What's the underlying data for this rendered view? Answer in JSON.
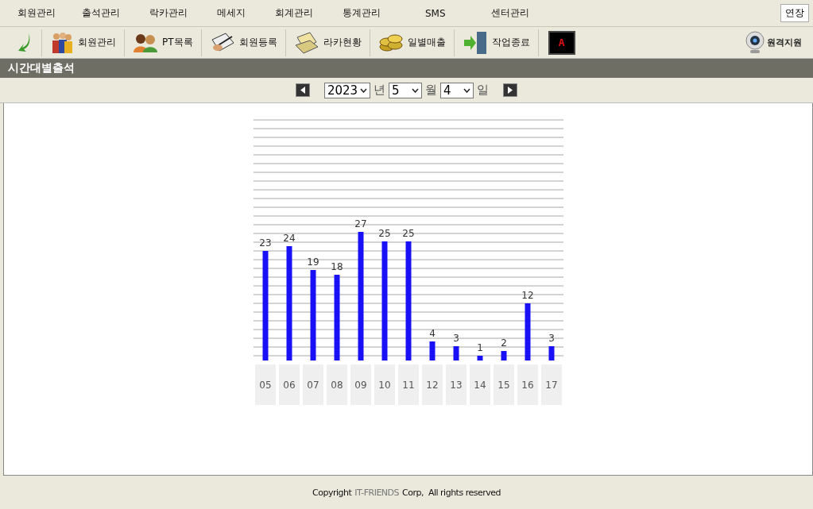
{
  "menu": [
    "회원관리",
    "출석관리",
    "락카관리",
    "메세지",
    "회계관리",
    "통계관리",
    "SMS",
    "센터관리"
  ],
  "extend_button": "연장",
  "toolbar": [
    {
      "kind": "arrow"
    },
    {
      "kind": "members",
      "label": "회원관리"
    },
    {
      "kind": "pt",
      "label": "PT목록"
    },
    {
      "kind": "register",
      "label": "회원등록"
    },
    {
      "kind": "locker",
      "label": "라카현황"
    },
    {
      "kind": "sales",
      "label": "일별매출"
    },
    {
      "kind": "exit",
      "label": "작업종료"
    },
    {
      "kind": "badge",
      "label": "A"
    }
  ],
  "remote_support": "원격지원",
  "section_title": "시간대별출석",
  "date": {
    "year": "2023",
    "year_unit": "년",
    "month": "5",
    "month_unit": "월",
    "day": "4",
    "day_unit": "일"
  },
  "chart_data": {
    "type": "bar",
    "categories": [
      "05",
      "06",
      "07",
      "08",
      "09",
      "10",
      "11",
      "12",
      "13",
      "14",
      "15",
      "16",
      "17"
    ],
    "data_labels": true,
    "series": [
      {
        "color": "#1a10f5",
        "values": [
          23,
          24,
          19,
          18,
          27,
          25,
          25,
          4,
          3,
          1,
          2,
          12,
          3
        ]
      }
    ]
  },
  "footer": {
    "prefix": "Copyright",
    "company": "IT-FRIENDS",
    "suffix": "Corp,  All rights reserved"
  }
}
